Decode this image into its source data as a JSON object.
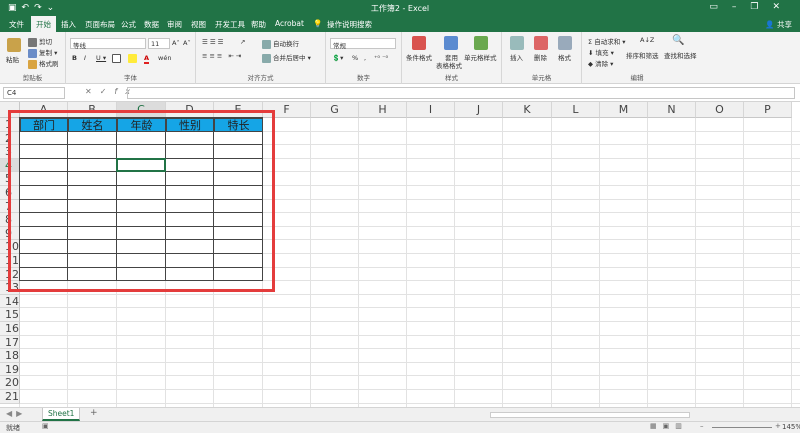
{
  "window": {
    "title": "工作簿2 - Excel",
    "quick_access": [
      "save-icon",
      "undo-icon",
      "redo-icon",
      "customize-icon"
    ],
    "controls": [
      "ribbon-options-icon",
      "minimize-icon",
      "restore-icon",
      "close-icon"
    ]
  },
  "tabs": [
    {
      "label": "文件"
    },
    {
      "label": "开始"
    },
    {
      "label": "插入"
    },
    {
      "label": "页面布局"
    },
    {
      "label": "公式"
    },
    {
      "label": "数据"
    },
    {
      "label": "审阅"
    },
    {
      "label": "视图"
    },
    {
      "label": "开发工具"
    },
    {
      "label": "帮助"
    },
    {
      "label": "Acrobat"
    }
  ],
  "tell_me": "操作说明搜索",
  "share": "共享",
  "ribbon": {
    "clipboard": {
      "paste": "粘贴",
      "cut": "剪切",
      "copy": "复制 ▾",
      "format_painter": "格式刷",
      "label": "剪贴板"
    },
    "font": {
      "name": "等线",
      "size": "11",
      "grow": "A˄",
      "shrink": "A˅",
      "bold": "B",
      "italic": "I",
      "underline": "U ▾",
      "font_color": "A",
      "wen": "wén",
      "label": "字体"
    },
    "alignment": {
      "wrap": "自动换行",
      "merge": "合并后居中 ▾",
      "label": "对齐方式"
    },
    "number": {
      "format": "常规",
      "percent": "%",
      "comma": ",",
      "label": "数字"
    },
    "styles": {
      "conditional": "条件格式",
      "table": "套用",
      "table2": "表格格式",
      "cell_styles": "单元格样式",
      "label": "样式"
    },
    "cells": {
      "insert": "插入",
      "delete": "删除",
      "format": "格式",
      "label": "单元格"
    },
    "editing": {
      "autosum": "自动求和 ▾",
      "fill": "填充 ▾",
      "clear": "清除 ▾",
      "sort": "排序和筛选",
      "find": "查找和选择",
      "label": "编辑"
    }
  },
  "formula_bar": {
    "name_box": "C4",
    "fx": "fx",
    "value": ""
  },
  "columns": [
    "A",
    "B",
    "C",
    "D",
    "E",
    "F",
    "G",
    "H",
    "I",
    "J",
    "K",
    "L",
    "M",
    "N",
    "O",
    "P"
  ],
  "rows": [
    "1",
    "2",
    "3",
    "4",
    "5",
    "6",
    "7",
    "8",
    "9",
    "10",
    "11",
    "12",
    "13",
    "14",
    "15",
    "16",
    "17",
    "18",
    "19",
    "20",
    "21"
  ],
  "table": {
    "headers": [
      "部门",
      "姓名",
      "年龄",
      "性别",
      "特长"
    ],
    "header_fill": "#15a5e6",
    "bordered_rows": 12
  },
  "selected_cell": "C4",
  "annotation_color": "#e43c3c",
  "sheets": [
    {
      "name": "Sheet1"
    }
  ],
  "add_sheet": "+",
  "status": {
    "mode": "就绪",
    "zoom": "145%"
  },
  "accent": "#217346"
}
